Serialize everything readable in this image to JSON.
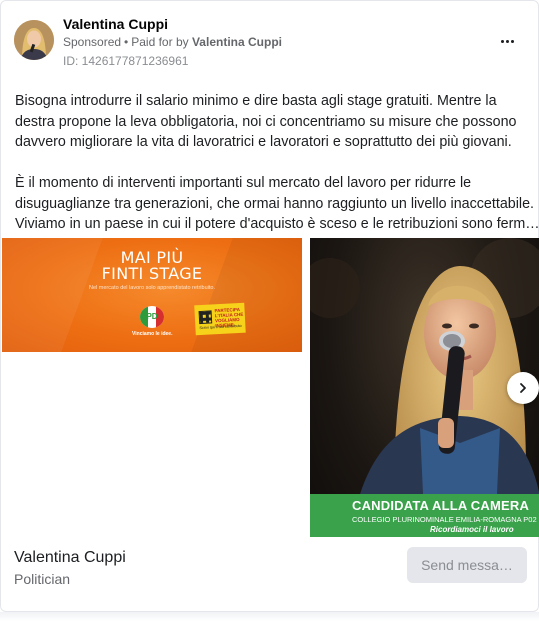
{
  "post": {
    "author": "Valentina Cuppi",
    "sponsored_label": "Sponsored",
    "separator": "•",
    "paid_for_prefix": "Paid for by",
    "paid_for_by": "Valentina Cuppi",
    "ad_id": "ID: 1426177871236961",
    "body_lines": [
      "Bisogna introdurre il salario minimo e dire basta agli stage gratuiti. Mentre la",
      "destra propone la leva obbligatoria, noi ci concentriamo su misure che possono",
      "davvero migliorare la vita di lavoratrici e lavoratori e soprattutto dei più giovani.",
      "",
      "È il momento di interventi importanti sul mercato del lavoro per ridurre le",
      "disuguaglianze tra generazioni, che ormai hanno raggiunto un livello inaccettabile.",
      "Viviamo in un paese in cui il potere d'acquisto è sceso e le retribuzioni sono ferm…"
    ]
  },
  "creative_1": {
    "headline_1": "MAI PIÙ",
    "headline_2": "FINTI STAGE",
    "subtitle": "Nel mercato del lavoro solo apprendistato retribuito.",
    "party_logo_text": "PD",
    "party_caption": "Vinciamo le idee.",
    "box_title_1": "PARTECIPA",
    "box_title_2": "L'ITALIA CHE",
    "box_title_3": "VOGLIAMO INSIEME.",
    "box_footer": "Scrivi qui il tuo contributo"
  },
  "creative_2": {
    "banner_title": "CANDIDATA ALLA CAMERA",
    "banner_subtitle": "COLLEGIO PLURINOMINALE EMILIA-ROMAGNA P02",
    "banner_tagline": "Ricordiamoci il lavoro"
  },
  "footer": {
    "page_name": "Valentina Cuppi",
    "page_category": "Politician",
    "send_button": "Send messa…"
  },
  "icons": {
    "more": "more-horizontal-icon",
    "next": "chevron-right-icon"
  },
  "colors": {
    "promo_orange": "#ee6f13",
    "banner_green": "#3aa24b",
    "button_gray": "#e4e6eb"
  }
}
